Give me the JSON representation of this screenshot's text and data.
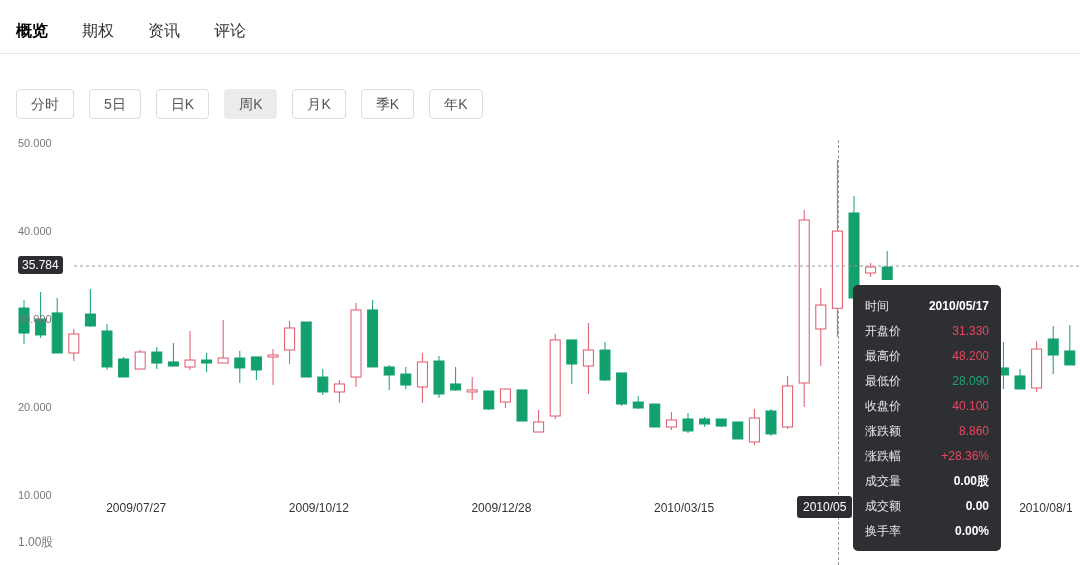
{
  "tabs": [
    {
      "label": "概览",
      "selected": true
    },
    {
      "label": "期权",
      "selected": false
    },
    {
      "label": "资讯",
      "selected": false
    },
    {
      "label": "评论",
      "selected": false
    }
  ],
  "periods": [
    {
      "label": "分时",
      "selected": false
    },
    {
      "label": "5日",
      "selected": false
    },
    {
      "label": "日K",
      "selected": false
    },
    {
      "label": "周K",
      "selected": true
    },
    {
      "label": "月K",
      "selected": false
    },
    {
      "label": "季K",
      "selected": false
    },
    {
      "label": "年K",
      "selected": false
    }
  ],
  "chart": {
    "chart_data": {
      "type": "candlestick",
      "categories": [
        null,
        null,
        null,
        null,
        null,
        null,
        null,
        "2009/07/27",
        null,
        null,
        null,
        null,
        null,
        null,
        null,
        null,
        null,
        null,
        "2009/10/12",
        null,
        null,
        null,
        null,
        null,
        null,
        null,
        null,
        null,
        null,
        "2009/12/28",
        null,
        null,
        null,
        null,
        null,
        null,
        null,
        null,
        null,
        null,
        "2010/03/15",
        null,
        null,
        null,
        null,
        null,
        null,
        null,
        null,
        null,
        null,
        null,
        null,
        null,
        null,
        null,
        null,
        null,
        null,
        null,
        null,
        null,
        "2010/08/1",
        null
      ],
      "ohlc": [
        [
          31.36,
          32.27,
          27.27,
          28.52
        ],
        [
          30.11,
          33.18,
          27.95,
          28.3
        ],
        [
          30.8,
          32.5,
          26.25,
          26.25
        ],
        [
          26.25,
          28.98,
          25.34,
          28.41
        ],
        [
          30.68,
          33.52,
          29.2,
          29.32
        ],
        [
          28.75,
          29.55,
          24.32,
          24.66
        ],
        [
          25.57,
          25.8,
          23.52,
          23.52
        ],
        [
          24.43,
          26.59,
          24.43,
          26.36
        ],
        [
          26.36,
          26.93,
          24.43,
          25.11
        ],
        [
          25.23,
          27.39,
          24.77,
          24.77
        ],
        [
          24.66,
          28.75,
          24.32,
          25.45
        ],
        [
          25.45,
          26.25,
          24.09,
          25.11
        ],
        [
          25.11,
          30.0,
          25.11,
          25.68
        ],
        [
          25.68,
          26.48,
          22.84,
          24.55
        ],
        [
          25.8,
          25.8,
          23.18,
          24.32
        ],
        [
          25.8,
          26.7,
          22.61,
          26.02
        ],
        [
          26.59,
          29.89,
          25.0,
          29.09
        ],
        [
          29.77,
          29.77,
          23.52,
          23.52
        ],
        [
          23.52,
          24.43,
          21.48,
          21.82
        ],
        [
          21.82,
          23.18,
          20.57,
          22.73
        ],
        [
          23.52,
          31.93,
          22.39,
          31.14
        ],
        [
          31.14,
          32.27,
          24.66,
          24.66
        ],
        [
          24.66,
          24.89,
          22.05,
          23.75
        ],
        [
          23.86,
          24.66,
          22.16,
          22.61
        ],
        [
          22.39,
          26.25,
          20.57,
          25.23
        ],
        [
          25.34,
          25.91,
          21.14,
          21.59
        ],
        [
          22.73,
          24.66,
          21.93,
          22.05
        ],
        [
          21.82,
          23.52,
          20.91,
          22.05
        ],
        [
          21.93,
          21.93,
          19.77,
          19.89
        ],
        [
          20.68,
          22.16,
          20.0,
          22.16
        ],
        [
          22.05,
          22.05,
          18.52,
          18.52
        ],
        [
          17.27,
          19.77,
          17.27,
          18.41
        ],
        [
          19.09,
          28.41,
          18.75,
          27.73
        ],
        [
          27.73,
          27.73,
          22.73,
          25.0
        ],
        [
          24.77,
          29.66,
          21.59,
          26.59
        ],
        [
          26.59,
          27.5,
          23.07,
          23.18
        ],
        [
          23.98,
          23.98,
          20.23,
          20.45
        ],
        [
          20.68,
          21.36,
          19.89,
          20.0
        ],
        [
          20.45,
          20.45,
          17.84,
          17.84
        ],
        [
          17.84,
          19.55,
          17.5,
          18.64
        ],
        [
          18.75,
          19.43,
          17.16,
          17.39
        ],
        [
          18.75,
          18.98,
          17.84,
          18.18
        ],
        [
          18.75,
          18.75,
          17.84,
          17.95
        ],
        [
          18.41,
          18.41,
          16.48,
          16.48
        ],
        [
          16.14,
          19.89,
          15.8,
          18.86
        ],
        [
          19.66,
          19.89,
          16.82,
          17.05
        ],
        [
          17.84,
          23.64,
          17.61,
          22.5
        ],
        [
          22.84,
          42.5,
          20.11,
          41.36
        ],
        [
          28.98,
          33.64,
          24.77,
          31.7
        ],
        [
          31.33,
          48.2,
          28.09,
          40.1
        ],
        [
          42.16,
          44.09,
          32.5,
          32.5
        ],
        [
          35.34,
          36.48,
          34.89,
          36.02
        ],
        [
          36.02,
          37.84,
          34.6,
          34.6
        ],
        null,
        null,
        null,
        null,
        null,
        null,
        [
          24.55,
          27.5,
          22.16,
          23.75
        ],
        [
          23.64,
          24.43,
          22.16,
          22.16
        ],
        [
          22.27,
          27.61,
          21.82,
          26.7
        ],
        [
          27.84,
          29.32,
          23.86,
          26.02
        ],
        [
          26.48,
          29.43,
          24.89,
          24.89
        ]
      ],
      "ylim": [
        2.16,
        66.36
      ],
      "yticks": [
        {
          "value": 50,
          "label": "50.000"
        },
        {
          "value": 40,
          "label": "40.000"
        },
        {
          "value": 30,
          "label": "30.000"
        },
        {
          "value": 20,
          "label": "20.000"
        },
        {
          "value": 10,
          "label": "10.000"
        }
      ]
    },
    "crosshair_price": "35.784",
    "crosshair_date": "2010/05",
    "volume_label": "1.00股",
    "tooltip": [
      {
        "label": "时间",
        "value": "2010/05/17",
        "kind": "plain"
      },
      {
        "label": "开盘价",
        "value": "31.330",
        "kind": "up"
      },
      {
        "label": "最高价",
        "value": "48.200",
        "kind": "up"
      },
      {
        "label": "最低价",
        "value": "28.090",
        "kind": "down"
      },
      {
        "label": "收盘价",
        "value": "40.100",
        "kind": "up"
      },
      {
        "label": "涨跌额",
        "value": "8.860",
        "kind": "up"
      },
      {
        "label": "涨跌幅",
        "value": "+28.36%",
        "kind": "up"
      },
      {
        "label": "成交量",
        "value": "0.00股",
        "kind": "plain"
      },
      {
        "label": "成交额",
        "value": "0.00",
        "kind": "plain"
      },
      {
        "label": "换手率",
        "value": "0.00%",
        "kind": "plain"
      }
    ]
  }
}
